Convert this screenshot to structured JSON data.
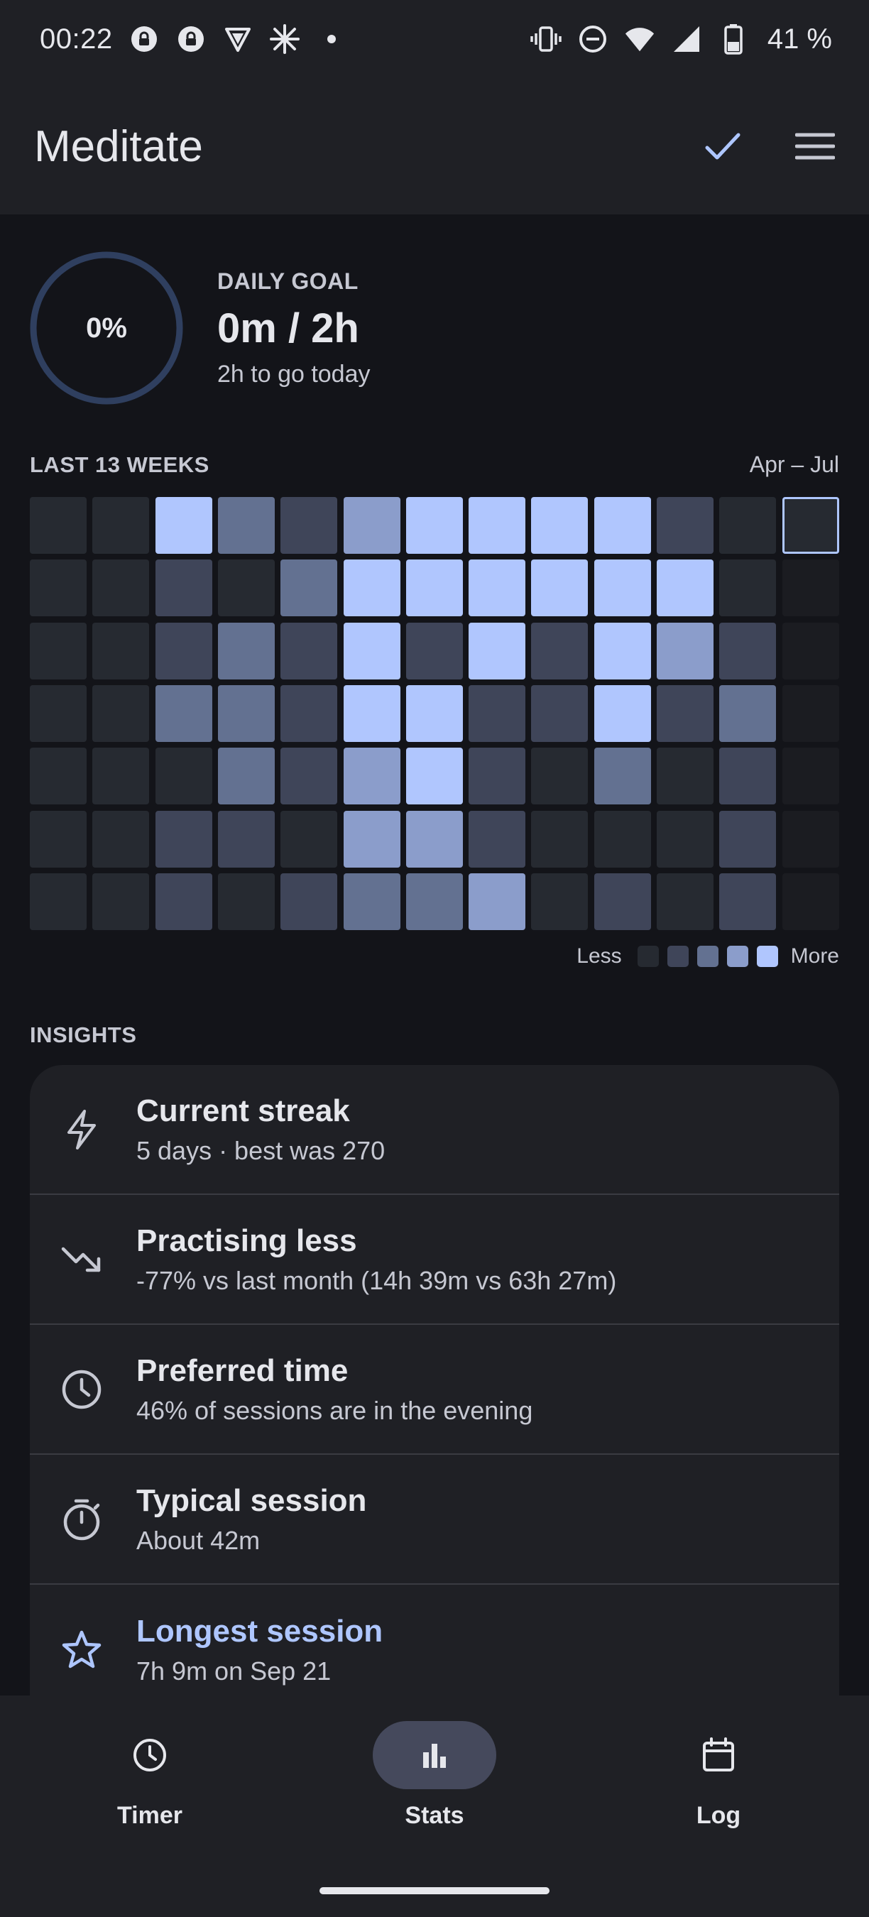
{
  "status_bar": {
    "time": "00:22",
    "battery": "41 %",
    "left_icons": [
      "lock-badge-icon",
      "lock-badge-icon",
      "shield-icon",
      "sparkle-icon",
      "dot-icon"
    ],
    "right_icons": [
      "vibrate-icon",
      "dnd-icon",
      "wifi-icon",
      "signal-icon",
      "battery-icon"
    ]
  },
  "app_bar": {
    "title": "Meditate",
    "actions": [
      "check-icon",
      "menu-icon"
    ]
  },
  "goal": {
    "percent": "0%",
    "progress_fraction": 0,
    "label": "DAILY GOAL",
    "value": "0m / 2h",
    "sub": "2h to go today"
  },
  "heatmap": {
    "label": "LAST 13 WEEKS",
    "range": "Apr – Jul",
    "levels": [
      [
        0,
        0,
        0,
        0,
        0,
        0,
        0
      ],
      [
        0,
        0,
        0,
        0,
        0,
        0,
        0
      ],
      [
        4,
        1,
        1,
        2,
        0,
        1,
        1
      ],
      [
        2,
        0,
        2,
        2,
        2,
        1,
        0
      ],
      [
        1,
        2,
        1,
        1,
        1,
        0,
        1
      ],
      [
        3,
        4,
        4,
        4,
        3,
        3,
        2
      ],
      [
        4,
        4,
        1,
        4,
        4,
        3,
        2
      ],
      [
        4,
        4,
        4,
        1,
        1,
        1,
        3
      ],
      [
        4,
        4,
        1,
        1,
        0,
        0,
        0
      ],
      [
        4,
        4,
        4,
        4,
        2,
        0,
        1
      ],
      [
        1,
        4,
        3,
        1,
        0,
        0,
        0
      ],
      [
        0,
        0,
        1,
        2,
        1,
        1,
        1
      ],
      [
        0,
        -1,
        -1,
        -1,
        -1,
        -1,
        -1
      ]
    ],
    "today": [
      12,
      0
    ],
    "colors": {
      "empty": "#262a31",
      "future": "#1b1c21",
      "l1": "#3f4559",
      "l2": "#637191",
      "l3": "#8b9dcb",
      "l4": "#b0c6fe",
      "today_border": "#aec6ff"
    },
    "legend": {
      "less": "Less",
      "more": "More"
    }
  },
  "insights": {
    "label": "INSIGHTS",
    "items": [
      {
        "icon": "bolt-icon",
        "title": "Current streak",
        "sub": "5 days · best was 270"
      },
      {
        "icon": "trending-down-icon",
        "title": "Practising less",
        "sub": "-77% vs last month (14h 39m vs 63h 27m)"
      },
      {
        "icon": "clock-icon",
        "title": "Preferred time",
        "sub": "46% of sessions are in the evening"
      },
      {
        "icon": "stopwatch-icon",
        "title": "Typical session",
        "sub": "About 42m"
      },
      {
        "icon": "star-icon",
        "title": "Longest session",
        "sub": "7h 9m on Sep 21"
      }
    ]
  },
  "bottom_nav": {
    "items": [
      {
        "icon": "clock-icon",
        "label": "Timer"
      },
      {
        "icon": "bar-chart-icon",
        "label": "Stats",
        "active": true
      },
      {
        "icon": "calendar-icon",
        "label": "Log"
      }
    ]
  }
}
